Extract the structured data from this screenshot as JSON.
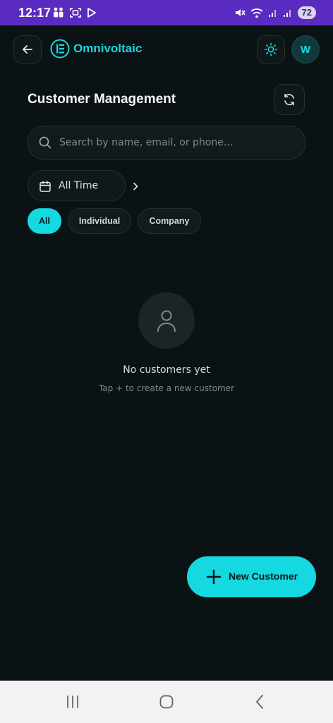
{
  "status_bar": {
    "time": "12:17",
    "battery": "72",
    "left_icons": [
      "people-icon",
      "screenshot-icon",
      "play-icon"
    ],
    "right_icons": [
      "mute-icon",
      "wifi-icon",
      "signal-icon",
      "signal-icon"
    ]
  },
  "header": {
    "brand": "Omnivoltaic",
    "avatar_initial": "W",
    "back_icon": "arrow-left-icon",
    "theme_icon": "sun-icon"
  },
  "page": {
    "title": "Customer Management",
    "refresh_icon": "refresh-icon"
  },
  "search": {
    "placeholder": "Search by name, email, or phone...",
    "value": ""
  },
  "date_filter": {
    "label": "All Time"
  },
  "filters": {
    "chips": [
      "All",
      "Individual",
      "Company"
    ],
    "selected": "All"
  },
  "empty_state": {
    "title": "No customers yet",
    "subtitle": "Tap + to create a new customer"
  },
  "fab": {
    "label": "New Customer"
  },
  "colors": {
    "accent": "#14d9e1",
    "background": "#0b1213",
    "status_bar": "#5a2bc0"
  }
}
